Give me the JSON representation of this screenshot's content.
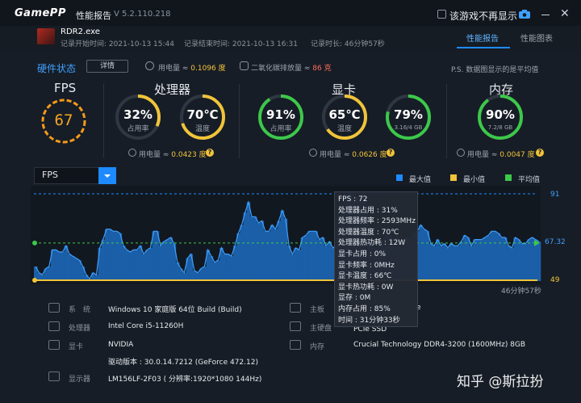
{
  "app": {
    "logo": "GamePP",
    "title": "性能报告",
    "version": "V 5.2.110.218",
    "hide_label": "该游戏不再显示"
  },
  "record": {
    "game": "RDR2.exe",
    "start": "记录开始时间: 2021-10-13 15:44",
    "end": "记录结束时间: 2021-10-13 16:31",
    "duration": "记录时长: 46分钟57秒"
  },
  "tabs": {
    "report": "性能报告",
    "chart": "性能图表"
  },
  "hardware": {
    "title": "硬件状态",
    "detail": "详情",
    "power_label": "用电量 ≈ ",
    "power_val": "0.1096 度",
    "co2_label": "二氧化碳排放量 ≈ ",
    "co2_val": "86 克",
    "note": "P.S. 数据图显示的是平均值"
  },
  "fps": {
    "title": "FPS",
    "value": "67"
  },
  "cpu": {
    "title": "处理器",
    "usage": "32%",
    "usage_label": "占用率",
    "usage_level": 0.32,
    "temp": "70℃",
    "temp_label": "温度",
    "temp_level": 0.7,
    "power_label": "用电量 ≈ ",
    "power_val": "0.0423 度"
  },
  "gpu": {
    "title": "显卡",
    "usage": "91%",
    "usage_label": "占用率",
    "usage_level": 0.91,
    "temp": "65℃",
    "temp_label": "温度",
    "temp_level": 0.65,
    "vram": "79%",
    "vram_label": "3.16/4 GB",
    "vram_level": 0.79,
    "power_label": "用电量 ≈ ",
    "power_val": "0.0626 度"
  },
  "mem": {
    "title": "内存",
    "usage": "90%",
    "usage_label": "7.2/8 GB",
    "usage_level": 0.9,
    "power_label": "用电量 ≈ ",
    "power_val": "0.0047 度"
  },
  "chart": {
    "select": "FPS",
    "legend": {
      "max": "最大值",
      "min": "最小值",
      "avg": "平均值"
    },
    "max_label": "91",
    "avg_label": "67.32",
    "min_label": "49",
    "duration": "46分钟57秒",
    "colors": {
      "max": "#1d8bff",
      "min": "#f0c43a",
      "avg": "#3cc84a"
    }
  },
  "chart_data": {
    "type": "area",
    "title": "",
    "xlabel": "",
    "ylabel": "FPS",
    "ylim": [
      49,
      91
    ],
    "max": 91,
    "min": 49,
    "avg": 67.32,
    "values": [
      56,
      53,
      52,
      55,
      56,
      64,
      64,
      63,
      63,
      66,
      62,
      61,
      60,
      59,
      56,
      52,
      50,
      53,
      52,
      65,
      69,
      74,
      74,
      73,
      73,
      72,
      66,
      64,
      63,
      64,
      64,
      66,
      62,
      64,
      65,
      73,
      73,
      66,
      68,
      69,
      70,
      67,
      58,
      55,
      53,
      60,
      62,
      54,
      53,
      55,
      56,
      64,
      61,
      58,
      59,
      65,
      62,
      62,
      61,
      66,
      72,
      76,
      82,
      87,
      80,
      80,
      77,
      78,
      73,
      73,
      76,
      74,
      78,
      83,
      79,
      66,
      62,
      65,
      64,
      70,
      71,
      73,
      73,
      73,
      69,
      70,
      66,
      68,
      65,
      66,
      75,
      85,
      90,
      91,
      90,
      89,
      88,
      91,
      84,
      69,
      65,
      63,
      69,
      68,
      72,
      71,
      67,
      70,
      67,
      66,
      70,
      69,
      72,
      73,
      76,
      74,
      73,
      67,
      66,
      69,
      66,
      67,
      65,
      67,
      66,
      66,
      68,
      71,
      70,
      66,
      69,
      69,
      69,
      70,
      71,
      73,
      73,
      72,
      70,
      70,
      66,
      65,
      70,
      69,
      67,
      67,
      69,
      70,
      69,
      68
    ]
  },
  "tooltip": [
    "FPS : 72",
    "处理器占用 : 31%",
    "处理器频率 : 2593MHz",
    "处理器温度 : 70℃",
    "处理器热功耗 : 12W",
    "显卡占用 : 0%",
    "显卡频率 : 0MHz",
    "显卡温度 : 66℃",
    "显卡热功耗 : 0W",
    "显存 : 0M",
    "内存占用 : 85%",
    "时间 : 31分钟33秒"
  ],
  "info": {
    "sys_label": "系　统",
    "sys_val": "Windows 10 家庭版 64位   Build (Build)",
    "cpu_label": "处理器",
    "cpu_val": "Intel Core i5-11260H",
    "gpu_label": "显卡",
    "gpu_val": "NVIDIA",
    "driver_val": "驱动版本 : 30.0.14.7212 (GeForce 472.12)",
    "disp_label": "显示器",
    "disp_val": "LM156LF-2F03 ( 分辨率:1920*1080 144Hz)",
    "board_label": "主板",
    "board_val": "e",
    "disk_label": "主硬盘",
    "disk_val": "PCIe SSD",
    "ram_label": "内存",
    "ram_val": "Crucial Technology DDR4-3200 (1600MHz) 8GB"
  },
  "watermark": "知乎 @斯拉扮"
}
